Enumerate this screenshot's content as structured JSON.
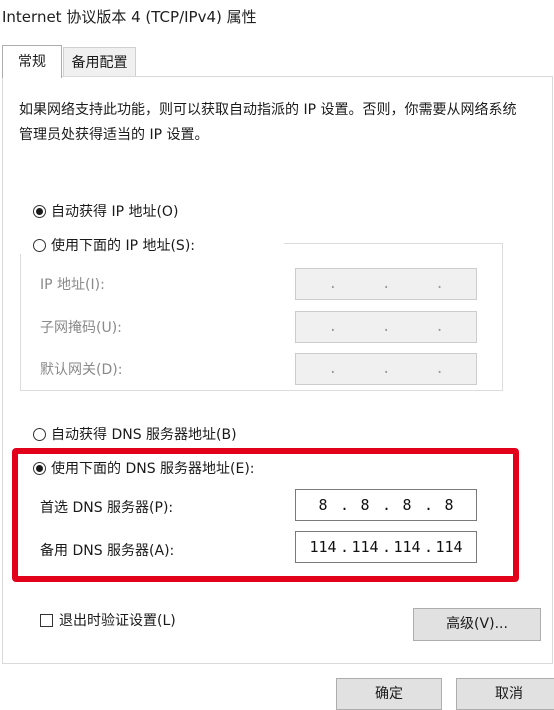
{
  "window": {
    "title": "Internet 协议版本 4 (TCP/IPv4) 属性"
  },
  "tabs": [
    {
      "label": "常规"
    },
    {
      "label": "备用配置"
    }
  ],
  "description": "如果网络支持此功能，则可以获取自动指派的 IP 设置。否则，你需要从网络系统管理员处获得适当的 IP 设置。",
  "ip_section": {
    "auto_label": "自动获得 IP 地址(O)",
    "manual_label": "使用下面的 IP 地址(S):",
    "auto_selected": true,
    "fields": [
      {
        "label": "IP 地址(I):",
        "value": [
          ".",
          ".",
          "."
        ]
      },
      {
        "label": "子网掩码(U):",
        "value": [
          ".",
          ".",
          "."
        ]
      },
      {
        "label": "默认网关(D):",
        "value": [
          ".",
          ".",
          "."
        ]
      }
    ]
  },
  "dns_section": {
    "auto_label": "自动获得 DNS 服务器地址(B)",
    "manual_label": "使用下面的 DNS 服务器地址(E):",
    "manual_selected": true,
    "preferred_label": "首选 DNS 服务器(P):",
    "preferred_value": [
      "8",
      "8",
      "8",
      "8"
    ],
    "alternate_label": "备用 DNS 服务器(A):",
    "alternate_value": [
      "114",
      "114",
      "114",
      "114"
    ]
  },
  "validate_label": "退出时验证设置(L)",
  "advanced_label": "高级(V)...",
  "ok_label": "确定",
  "cancel_label": "取消",
  "highlight_color": "#e3001b"
}
